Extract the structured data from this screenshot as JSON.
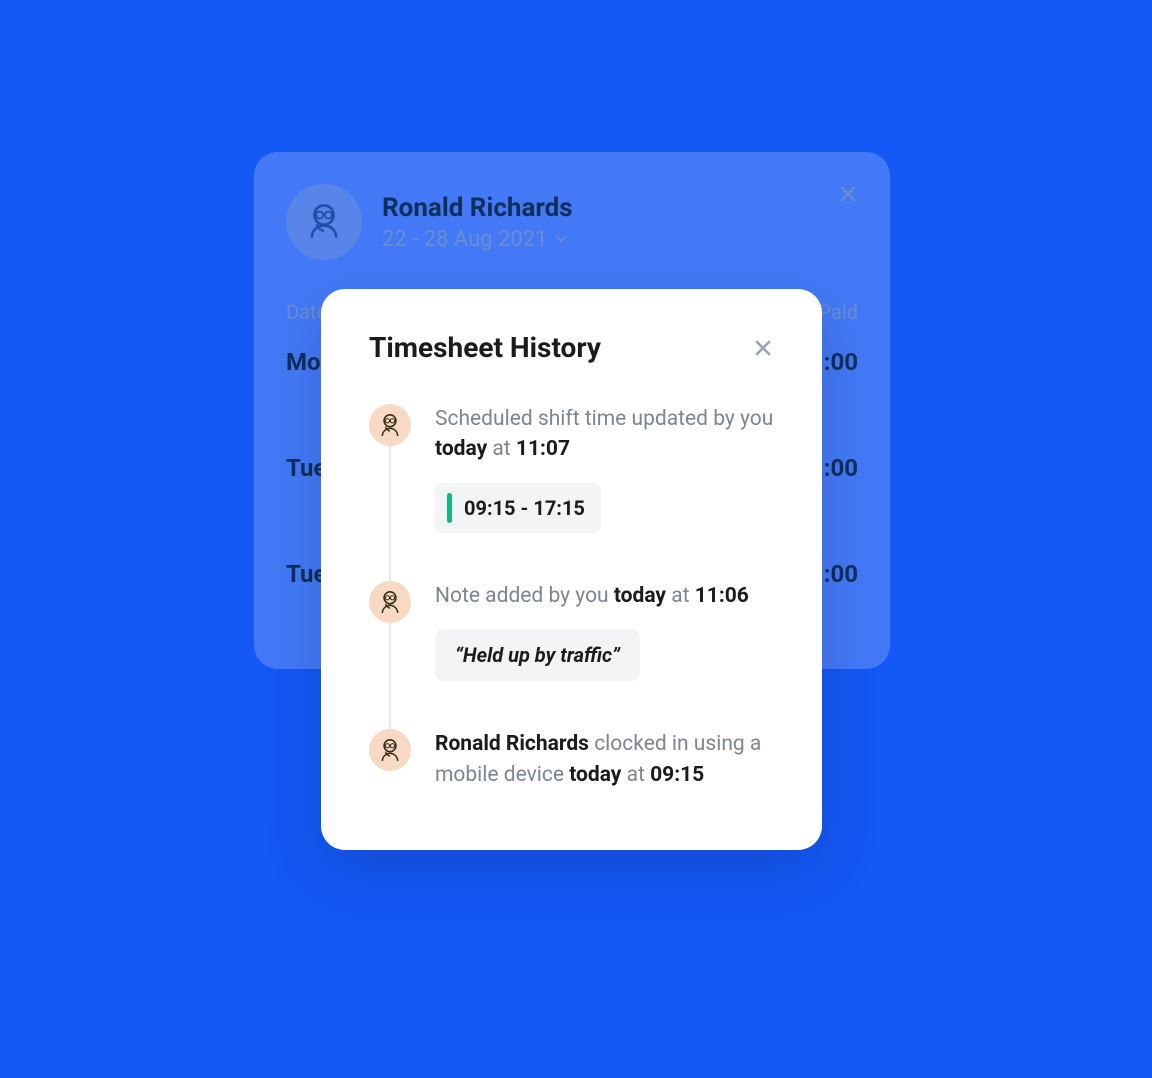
{
  "background_card": {
    "name": "Ronald Richards",
    "date_range": "22 - 28 Aug 2021",
    "columns": {
      "date": "Date",
      "paid": "Paid"
    },
    "rows": [
      {
        "day": "Mon",
        "time": ":00"
      },
      {
        "day": "Tue",
        "time": ":00"
      },
      {
        "day": "Tue",
        "time": ":00"
      }
    ]
  },
  "modal": {
    "title": "Timesheet History",
    "events": [
      {
        "text_pre": "Scheduled shift time updated by you ",
        "today": "today",
        "at": " at ",
        "time": "11:07",
        "chip": "09:15 - 17:15"
      },
      {
        "text_pre": "Note added by you ",
        "today": "today",
        "at": " at ",
        "time": "11:06",
        "note": "“Held up by traffic”"
      },
      {
        "lead": "Ronald Richards",
        "text_mid": " clocked in using a mobile device ",
        "today": "today",
        "at": " at ",
        "time": "09:15"
      }
    ]
  }
}
